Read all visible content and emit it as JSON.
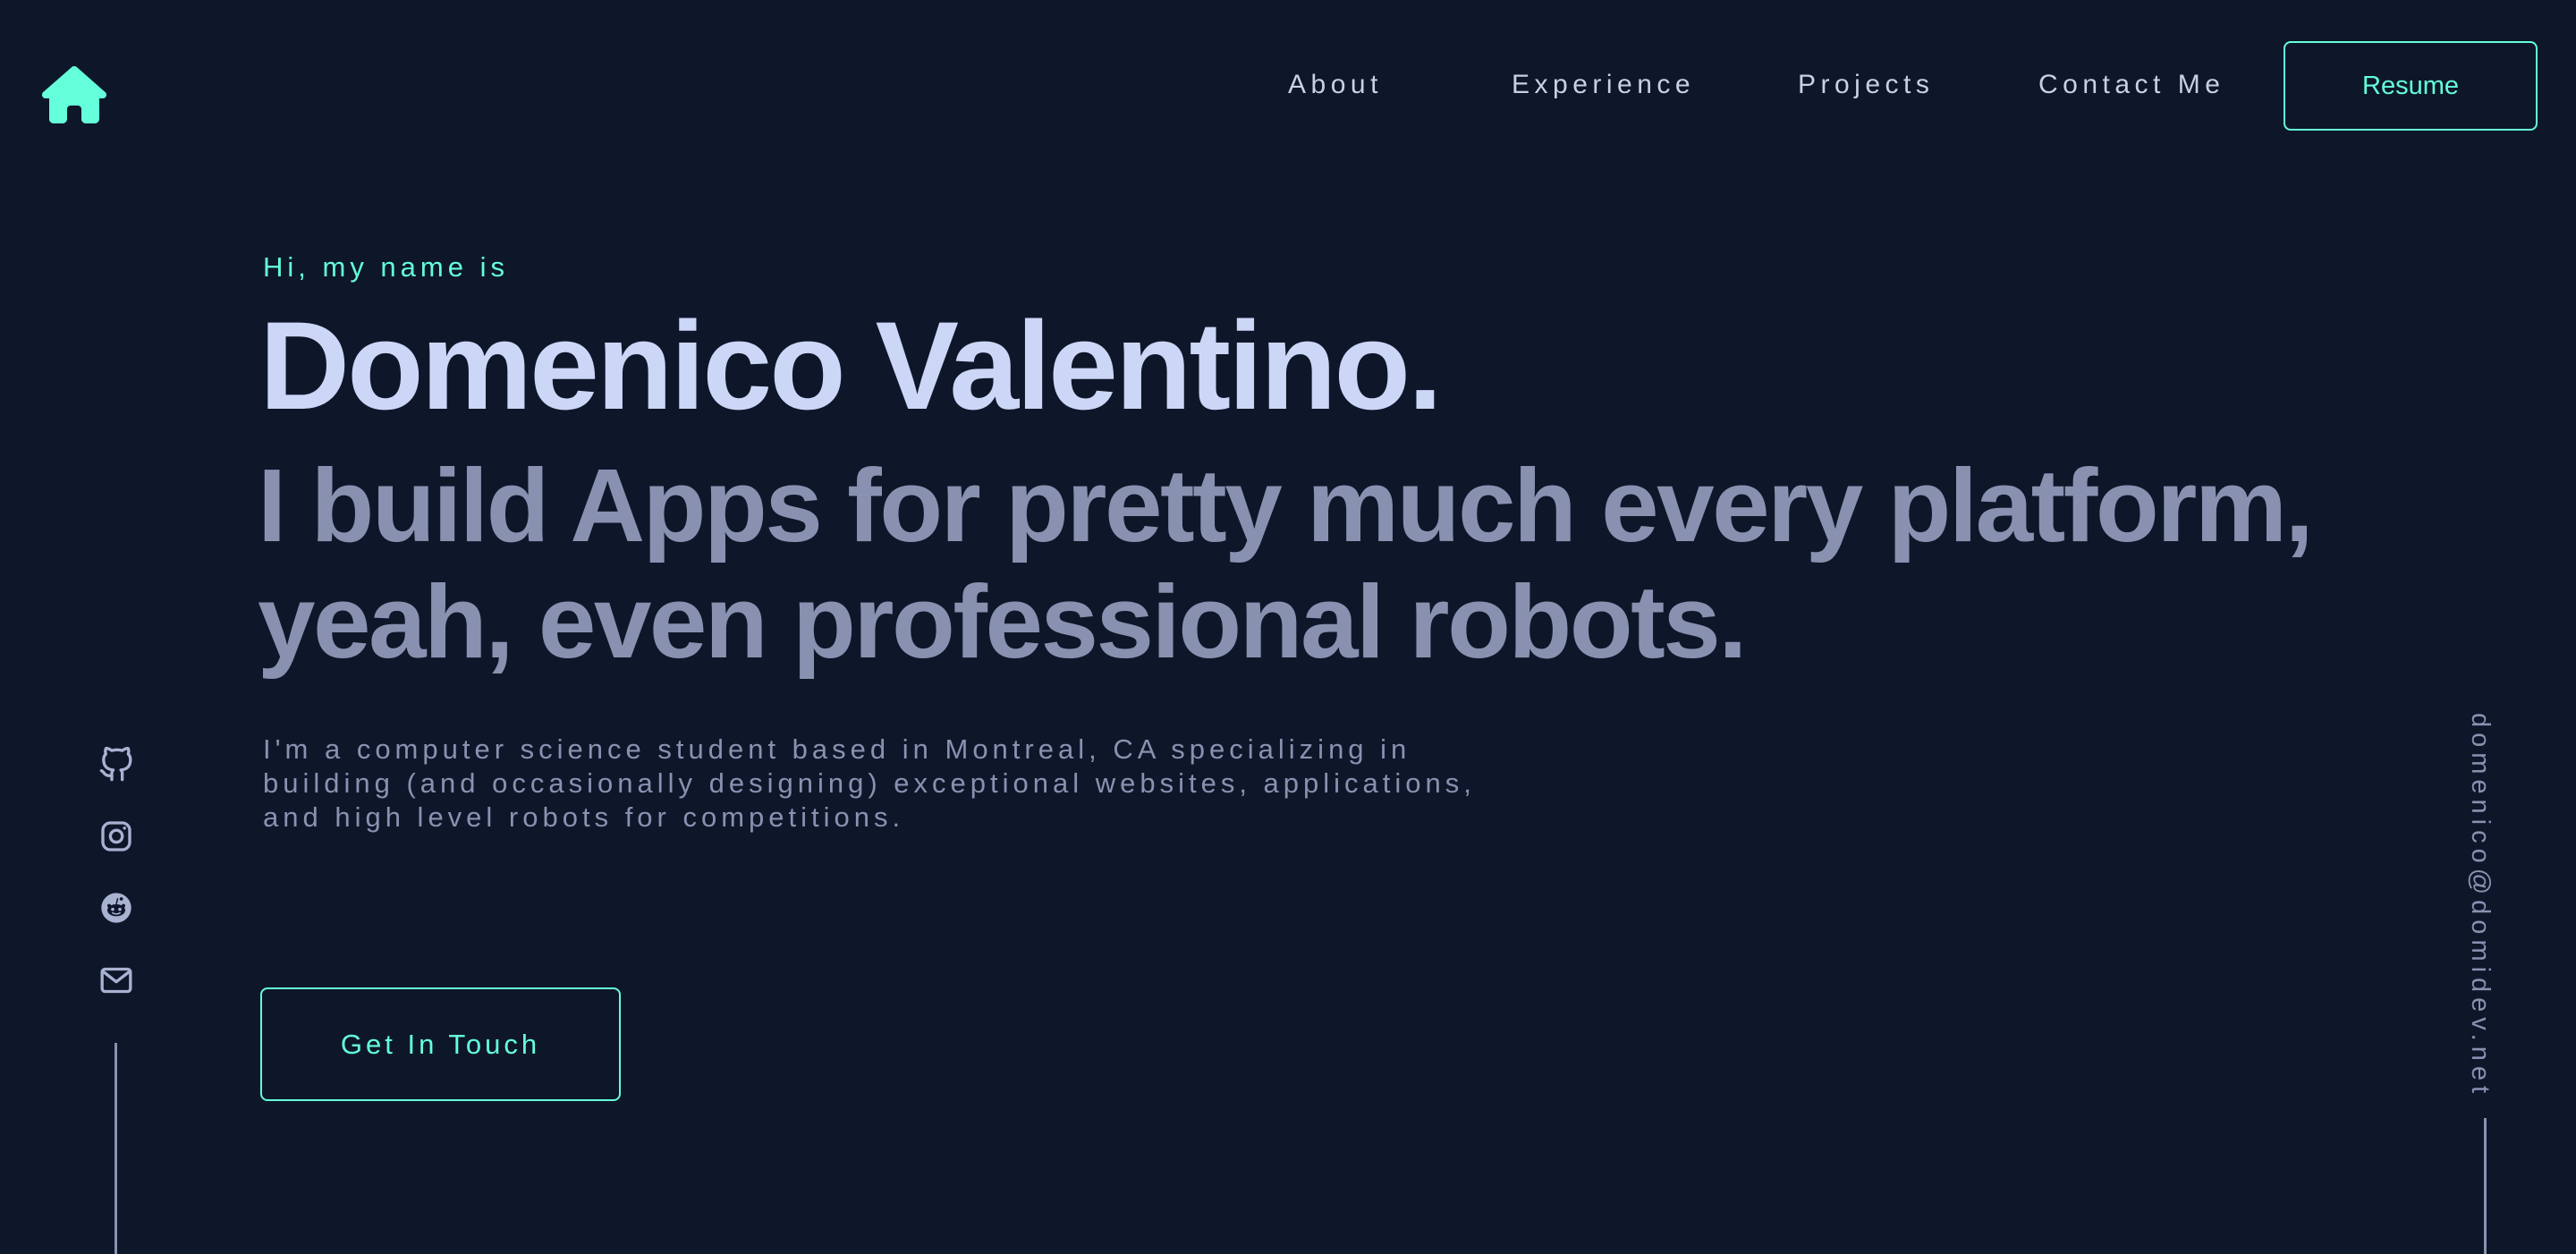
{
  "colors": {
    "background": "#0e172a",
    "accent": "#64ffda",
    "heading": "#ccd6f6",
    "muted": "#8892b0",
    "nav_text": "#c7d0e4"
  },
  "header": {
    "logo_icon": "home-icon",
    "nav": [
      {
        "label": "About"
      },
      {
        "label": "Experience"
      },
      {
        "label": "Projects"
      },
      {
        "label": "Contact Me"
      }
    ],
    "resume_label": "Resume"
  },
  "hero": {
    "greeting": "Hi, my name is",
    "name": "Domenico Valentino.",
    "tagline": "I build Apps for pretty much every platform, yeah, even professional robots.",
    "bio": "I'm a computer science student based in Montreal, CA specializing in building (and occasionally designing) exceptional websites, applications, and high level robots for competitions.",
    "cta_label": "Get In Touch"
  },
  "social": [
    {
      "icon": "github-icon"
    },
    {
      "icon": "instagram-icon"
    },
    {
      "icon": "reddit-icon"
    },
    {
      "icon": "email-icon"
    }
  ],
  "contact_email": "domenico@domidev.net"
}
